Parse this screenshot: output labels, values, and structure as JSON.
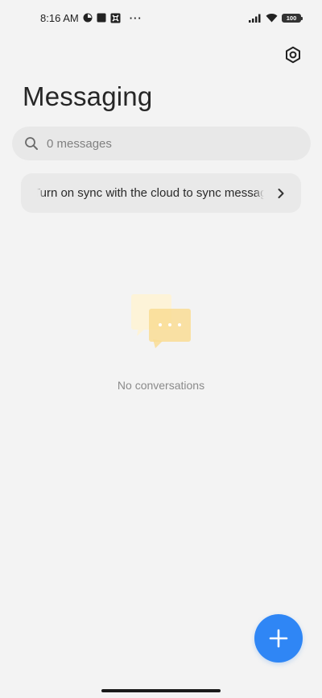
{
  "status_bar": {
    "time": "8:16 AM",
    "more": "···",
    "battery": "100"
  },
  "header": {
    "title": "Messaging",
    "settings_icon": "settings-hexagon-icon"
  },
  "search": {
    "placeholder": "0 messages",
    "icon": "search-icon"
  },
  "sync_banner": {
    "text": "Turn on sync with the cloud to sync messages",
    "icon": "chevron-right-icon"
  },
  "empty_state": {
    "text": "No conversations",
    "icon": "chat-bubbles-icon"
  },
  "fab": {
    "icon": "plus-icon"
  },
  "colors": {
    "background": "#f3f3f3",
    "accent": "#2f86f5",
    "bubble_light": "#fdf3d8",
    "bubble_dark": "#f9dc94"
  }
}
